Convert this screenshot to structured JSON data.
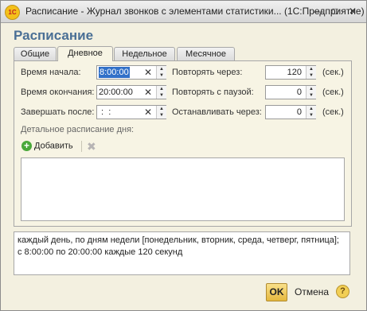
{
  "window": {
    "title": "Расписание - Журнал звонков с элементами статистики... (1С:Предприятие)",
    "icon_text": "1С",
    "min_glyph": "—",
    "max_glyph": "□",
    "close_glyph": "✕"
  },
  "form": {
    "title": "Расписание",
    "title_color": "#4a6f95"
  },
  "tabs": [
    {
      "label": "Общие"
    },
    {
      "label": "Дневное",
      "active": true
    },
    {
      "label": "Недельное"
    },
    {
      "label": "Месячное"
    }
  ],
  "fields": {
    "start_time": {
      "label": "Время начала:",
      "value": "8:00:00"
    },
    "end_time": {
      "label": "Время окончания:",
      "value": "20:00:00"
    },
    "finish_after": {
      "label": "Завершать после:",
      "value": " :  : "
    },
    "repeat_every": {
      "label": "Повторять через:",
      "value": "120",
      "unit": "(сек.)"
    },
    "repeat_pause": {
      "label": "Повторять с паузой:",
      "value": "0",
      "unit": "(сек.)"
    },
    "stop_after": {
      "label": "Останавливать через:",
      "value": "0",
      "unit": "(сек.)"
    },
    "clear_glyph": "✕",
    "spin_up": "▲",
    "spin_down": "▼"
  },
  "details": {
    "label": "Детальное расписание дня:",
    "add_label": "Добавить",
    "add_glyph": "+",
    "delete_glyph": "✖"
  },
  "summary": {
    "line1": "каждый день, по дням недели [понедельник, вторник, среда, четверг, пятница];",
    "line2": "с 8:00:00 по 20:00:00 каждые 120 секунд"
  },
  "buttons": {
    "ok": "OK",
    "cancel": "Отмена",
    "help": "?"
  }
}
